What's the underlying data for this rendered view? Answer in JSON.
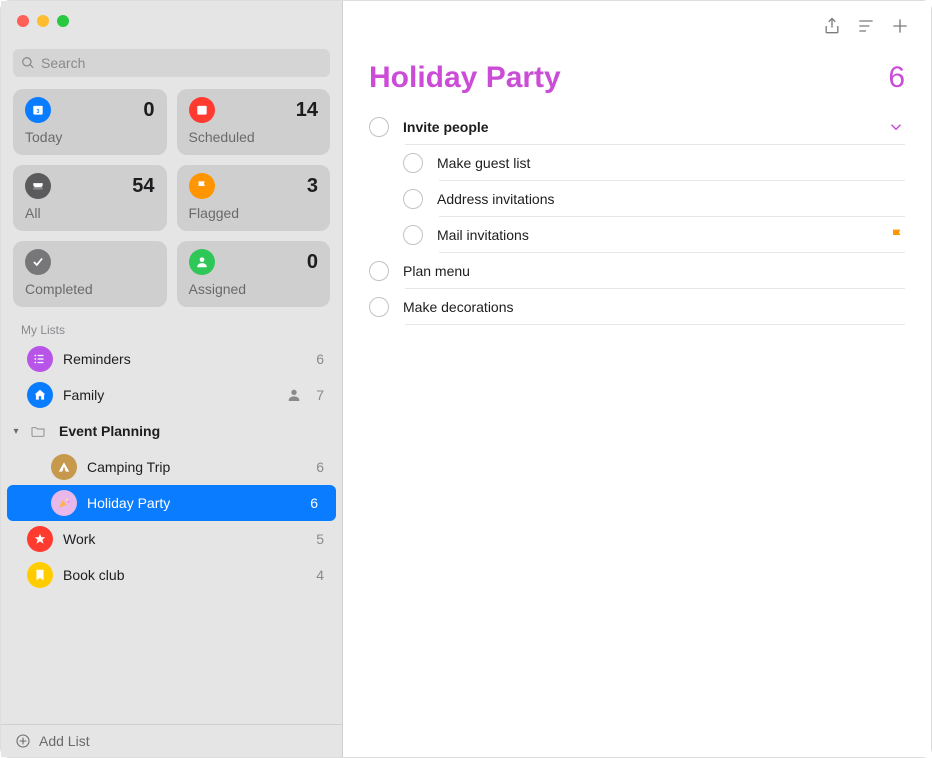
{
  "search": {
    "placeholder": "Search"
  },
  "smart": [
    {
      "id": "today",
      "label": "Today",
      "count": 0,
      "color": "#0a7cff"
    },
    {
      "id": "scheduled",
      "label": "Scheduled",
      "count": 14,
      "color": "#ff3b30"
    },
    {
      "id": "all",
      "label": "All",
      "count": 54,
      "color": "#5b5b5e"
    },
    {
      "id": "flagged",
      "label": "Flagged",
      "count": 3,
      "color": "#ff9500"
    },
    {
      "id": "completed",
      "label": "Completed",
      "count": "",
      "color": "#77777a"
    },
    {
      "id": "assigned",
      "label": "Assigned",
      "count": 0,
      "color": "#30c759"
    }
  ],
  "sidebar": {
    "section_label": "My Lists",
    "items": [
      {
        "name": "Reminders",
        "count": 6,
        "color": "#b855e8",
        "icon": "list",
        "shared": false
      },
      {
        "name": "Family",
        "count": 7,
        "color": "#0a7cff",
        "icon": "house",
        "shared": true
      }
    ],
    "group": {
      "name": "Event Planning",
      "children": [
        {
          "name": "Camping Trip",
          "count": 6,
          "color": "#c6994d",
          "icon": "tent",
          "selected": false
        },
        {
          "name": "Holiday Party",
          "count": 6,
          "color": "#e9b8ea",
          "icon": "party",
          "selected": true
        }
      ]
    },
    "more": [
      {
        "name": "Work",
        "count": 5,
        "color": "#ff3b30",
        "icon": "star"
      },
      {
        "name": "Book club",
        "count": 4,
        "color": "#ffcc00",
        "icon": "bookmark"
      }
    ],
    "add_label": "Add List"
  },
  "main": {
    "title": "Holiday Party",
    "count": 6,
    "accent": "#cb4cd7",
    "reminders": [
      {
        "title": "Invite people",
        "flagged": false,
        "bold": true,
        "expandable": true,
        "sub": [
          {
            "title": "Make guest list",
            "flagged": false
          },
          {
            "title": "Address invitations",
            "flagged": false
          },
          {
            "title": "Mail invitations",
            "flagged": true
          }
        ]
      },
      {
        "title": "Plan menu",
        "flagged": false
      },
      {
        "title": "Make decorations",
        "flagged": false
      }
    ]
  }
}
